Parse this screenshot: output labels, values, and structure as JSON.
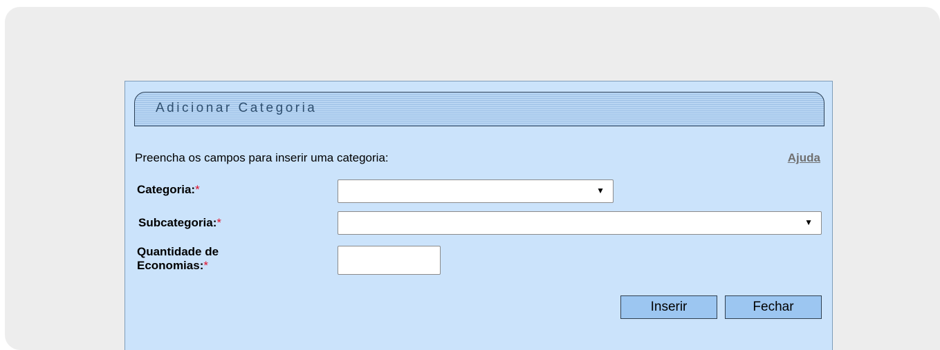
{
  "dialog": {
    "title": "Adicionar Categoria",
    "instructions": "Preencha os campos para inserir uma categoria:",
    "help_link": "Ajuda"
  },
  "form": {
    "categoria": {
      "label": "Categoria:",
      "required_marker": "*",
      "value": ""
    },
    "subcategoria": {
      "label": "Subcategoria:",
      "required_marker": "*",
      "value": ""
    },
    "quantidade": {
      "label_line1": "Quantidade de",
      "label_line2": "Economias:",
      "required_marker": "*",
      "value": ""
    }
  },
  "buttons": {
    "insert_label": "Inserir",
    "close_label": "Fechar"
  },
  "colors": {
    "dialog_bg": "#cbe3fb",
    "button_bg": "#9cc6f1",
    "required": "#e0102a"
  }
}
